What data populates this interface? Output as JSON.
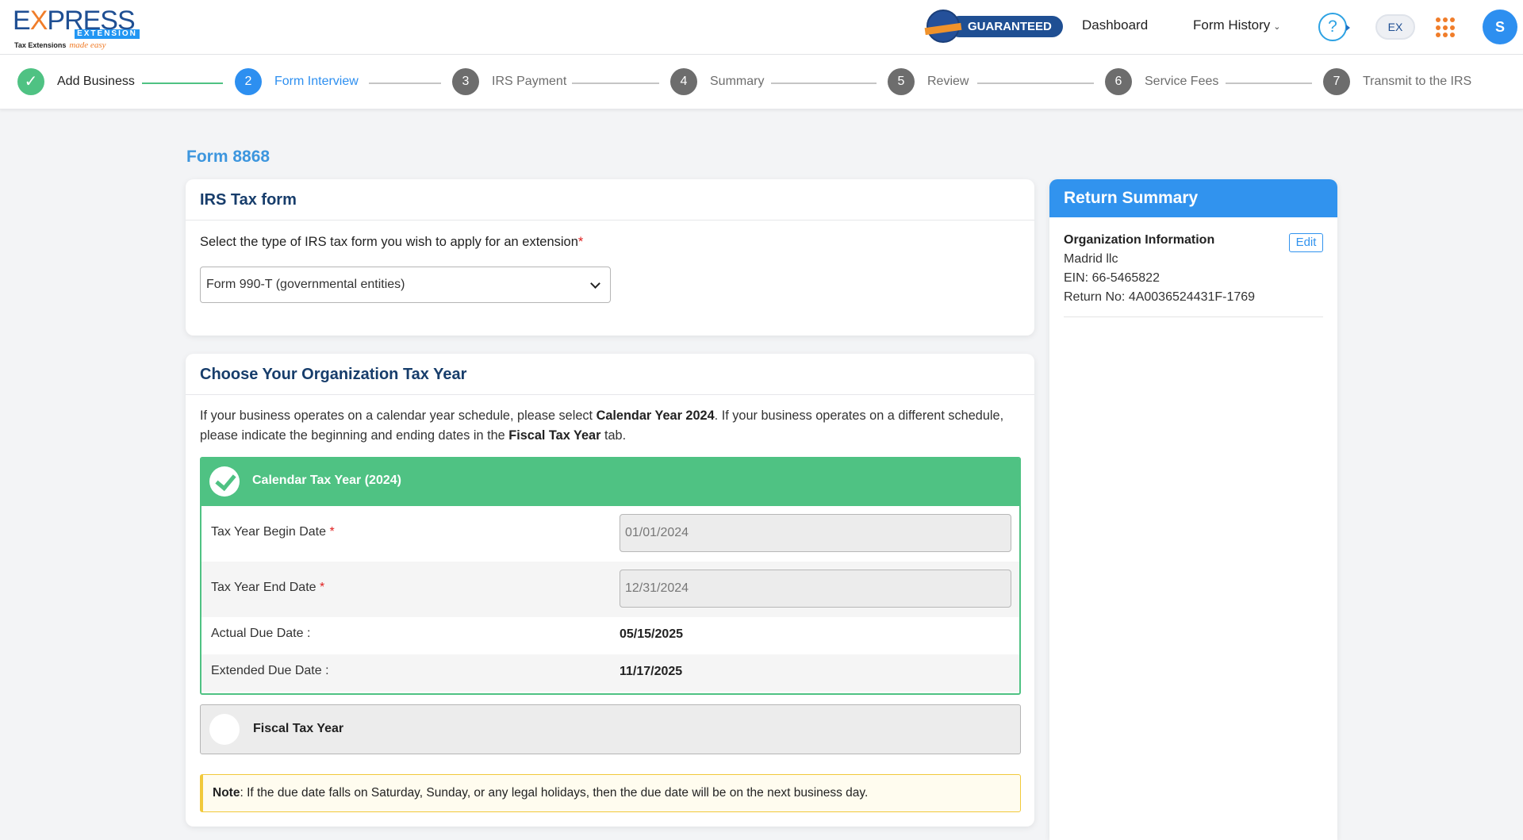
{
  "header": {
    "logo": {
      "main": "EXPRESS",
      "band": "EXTENSION",
      "tagline": "Tax Extensions",
      "tagline_script": "made easy"
    },
    "badge": "GUARANTEED",
    "nav": {
      "dashboard": "Dashboard",
      "form_history": "Form History"
    },
    "icons": {
      "help": "?",
      "ex": "EX",
      "avatar_initial": "S"
    }
  },
  "stepper": {
    "steps": [
      {
        "number": "✓",
        "label": "Add Business",
        "state": "done"
      },
      {
        "number": "2",
        "label": "Form Interview",
        "state": "active"
      },
      {
        "number": "3",
        "label": "IRS Payment",
        "state": "pending"
      },
      {
        "number": "4",
        "label": "Summary",
        "state": "pending"
      },
      {
        "number": "5",
        "label": "Review",
        "state": "pending"
      },
      {
        "number": "6",
        "label": "Service Fees",
        "state": "pending"
      },
      {
        "number": "7",
        "label": "Transmit to the IRS",
        "state": "pending"
      }
    ]
  },
  "page": {
    "title": "Form 8868"
  },
  "irs_form": {
    "heading": "IRS Tax form",
    "label": "Select the type of IRS tax form you wish to apply for an extension",
    "required_mark": "*",
    "selected": "Form 990-T (governmental entities)"
  },
  "tax_year": {
    "heading": "Choose Your Organization Tax Year",
    "intro": {
      "p1": "If your business operates on a calendar year schedule, please select ",
      "b1": "Calendar Year 2024",
      "p2": ". If your business operates on a different schedule, please indicate the beginning and ending dates in the ",
      "b2": "Fiscal Tax Year",
      "p3": " tab."
    },
    "calendar": {
      "title": "Calendar Tax Year (2024)",
      "selected": true,
      "begin_label": "Tax Year Begin Date",
      "begin_value": "01/01/2024",
      "end_label": "Tax Year End Date",
      "end_value": "12/31/2024",
      "actual_due_label": "Actual Due Date :",
      "actual_due_value": "05/15/2025",
      "extended_due_label": "Extended Due Date :",
      "extended_due_value": "11/17/2025",
      "required_mark": "*"
    },
    "fiscal": {
      "title": "Fiscal Tax Year",
      "selected": false
    },
    "note": {
      "label": "Note",
      "text": ": If the due date falls on Saturday, Sunday, or any legal holidays, then the due date will be on the next business day."
    }
  },
  "summary": {
    "heading": "Return Summary",
    "org_title": "Organization Information",
    "edit": "Edit",
    "org_name": "Madrid llc",
    "ein": "EIN: 66-5465822",
    "return_no": "Return No: 4A0036524431F-1769"
  },
  "colors": {
    "brand_blue": "#1f4f93",
    "accent_blue": "#2d8ff0",
    "success_green": "#4fc283",
    "orange": "#f07d2a",
    "note_yellow": "#f1c93b"
  }
}
